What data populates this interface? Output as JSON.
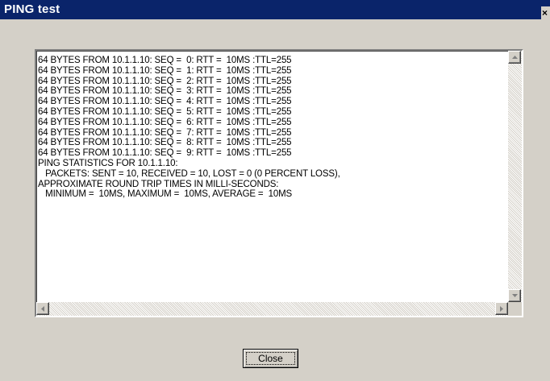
{
  "window": {
    "title": "PING test",
    "close_glyph": "×"
  },
  "output": {
    "lines": [
      "64 BYTES FROM 10.1.1.10: SEQ =  0: RTT =  10MS :TTL=255",
      "64 BYTES FROM 10.1.1.10: SEQ =  1: RTT =  10MS :TTL=255",
      "64 BYTES FROM 10.1.1.10: SEQ =  2: RTT =  10MS :TTL=255",
      "64 BYTES FROM 10.1.1.10: SEQ =  3: RTT =  10MS :TTL=255",
      "64 BYTES FROM 10.1.1.10: SEQ =  4: RTT =  10MS :TTL=255",
      "64 BYTES FROM 10.1.1.10: SEQ =  5: RTT =  10MS :TTL=255",
      "64 BYTES FROM 10.1.1.10: SEQ =  6: RTT =  10MS :TTL=255",
      "64 BYTES FROM 10.1.1.10: SEQ =  7: RTT =  10MS :TTL=255",
      "64 BYTES FROM 10.1.1.10: SEQ =  8: RTT =  10MS :TTL=255",
      "64 BYTES FROM 10.1.1.10: SEQ =  9: RTT =  10MS :TTL=255",
      "PING STATISTICS FOR 10.1.1.10:",
      "   PACKETS: SENT = 10, RECEIVED = 10, LOST = 0 (0 PERCENT LOSS),",
      "APPROXIMATE ROUND TRIP TIMES IN MILLI-SECONDS:",
      "   MINIMUM =  10MS, MAXIMUM =  10MS, AVERAGE =  10MS"
    ]
  },
  "buttons": {
    "close_label": "Close"
  },
  "icons": {
    "scroll_up": "scroll-up-arrow-icon",
    "scroll_down": "scroll-down-arrow-icon",
    "scroll_left": "scroll-left-arrow-icon",
    "scroll_right": "scroll-right-arrow-icon"
  },
  "colors": {
    "titlebar": "#0a246a",
    "face": "#d4d0c8"
  }
}
